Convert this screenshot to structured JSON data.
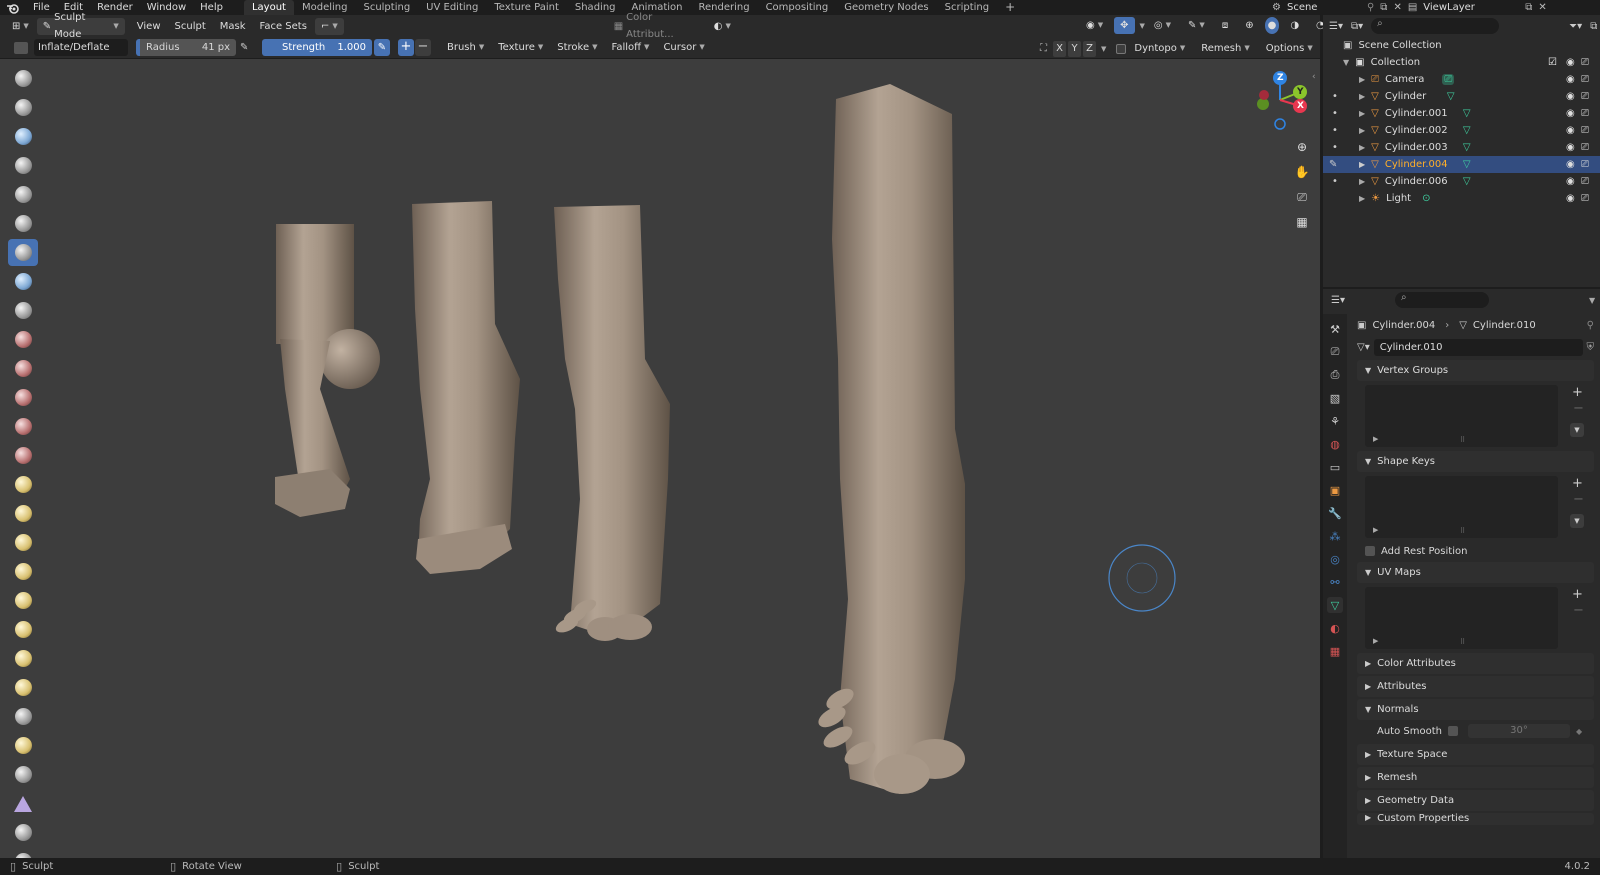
{
  "menus": {
    "file": "File",
    "edit": "Edit",
    "render": "Render",
    "window": "Window",
    "help": "Help"
  },
  "workspaces": [
    "Layout",
    "Modeling",
    "Sculpting",
    "UV Editing",
    "Texture Paint",
    "Shading",
    "Animation",
    "Rendering",
    "Compositing",
    "Geometry Nodes",
    "Scripting"
  ],
  "scene": "Scene",
  "view_layer": "ViewLayer",
  "header": {
    "mode": "Sculpt Mode",
    "view": "View",
    "sculpt": "Sculpt",
    "mask": "Mask",
    "face_sets": "Face Sets",
    "color_attribute": "Color Attribut..."
  },
  "tool_settings": {
    "brush_name": "Inflate/Deflate",
    "radius_label": "Radius",
    "radius_value": "41 px",
    "strength_label": "Strength",
    "strength_value": "1.000",
    "brush": "Brush",
    "texture": "Texture",
    "stroke": "Stroke",
    "falloff": "Falloff",
    "cursor": "Cursor",
    "x": "X",
    "y": "Y",
    "z": "Z",
    "dyntopo": "Dyntopo",
    "remesh": "Remesh",
    "options": "Options"
  },
  "outliner": {
    "scene_collection": "Scene Collection",
    "collection": "Collection",
    "items": [
      "Camera",
      "Cylinder",
      "Cylinder.001",
      "Cylinder.002",
      "Cylinder.003",
      "Cylinder.004",
      "Cylinder.006",
      "Light"
    ],
    "selected": "Cylinder.004"
  },
  "properties": {
    "object": "Cylinder.004",
    "mesh": "Cylinder.010",
    "mesh_field": "Cylinder.010",
    "panels": {
      "vertex_groups": "Vertex Groups",
      "shape_keys": "Shape Keys",
      "add_rest_position": "Add Rest Position",
      "uv_maps": "UV Maps",
      "color_attributes": "Color Attributes",
      "attributes": "Attributes",
      "normals": "Normals",
      "auto_smooth": "Auto Smooth",
      "auto_smooth_angle": "30°",
      "texture_space": "Texture Space",
      "remesh": "Remesh",
      "geometry_data": "Geometry Data",
      "custom_properties": "Custom Properties"
    }
  },
  "gizmo": {
    "x": "X",
    "y": "Y",
    "z": "Z"
  },
  "status": {
    "left": "Sculpt",
    "middle": "Rotate View",
    "right": "Sculpt",
    "version": "4.0.2"
  },
  "colors": {
    "accent": "#4772b3",
    "selected_row": "#334d80",
    "highlight_text": "#ffaf29",
    "mesh_icon": "#ed9a42",
    "data_icon": "#3fcfa0",
    "axis_x": "#e8374f",
    "axis_y": "#8bc52b",
    "axis_z": "#2f84e3"
  }
}
